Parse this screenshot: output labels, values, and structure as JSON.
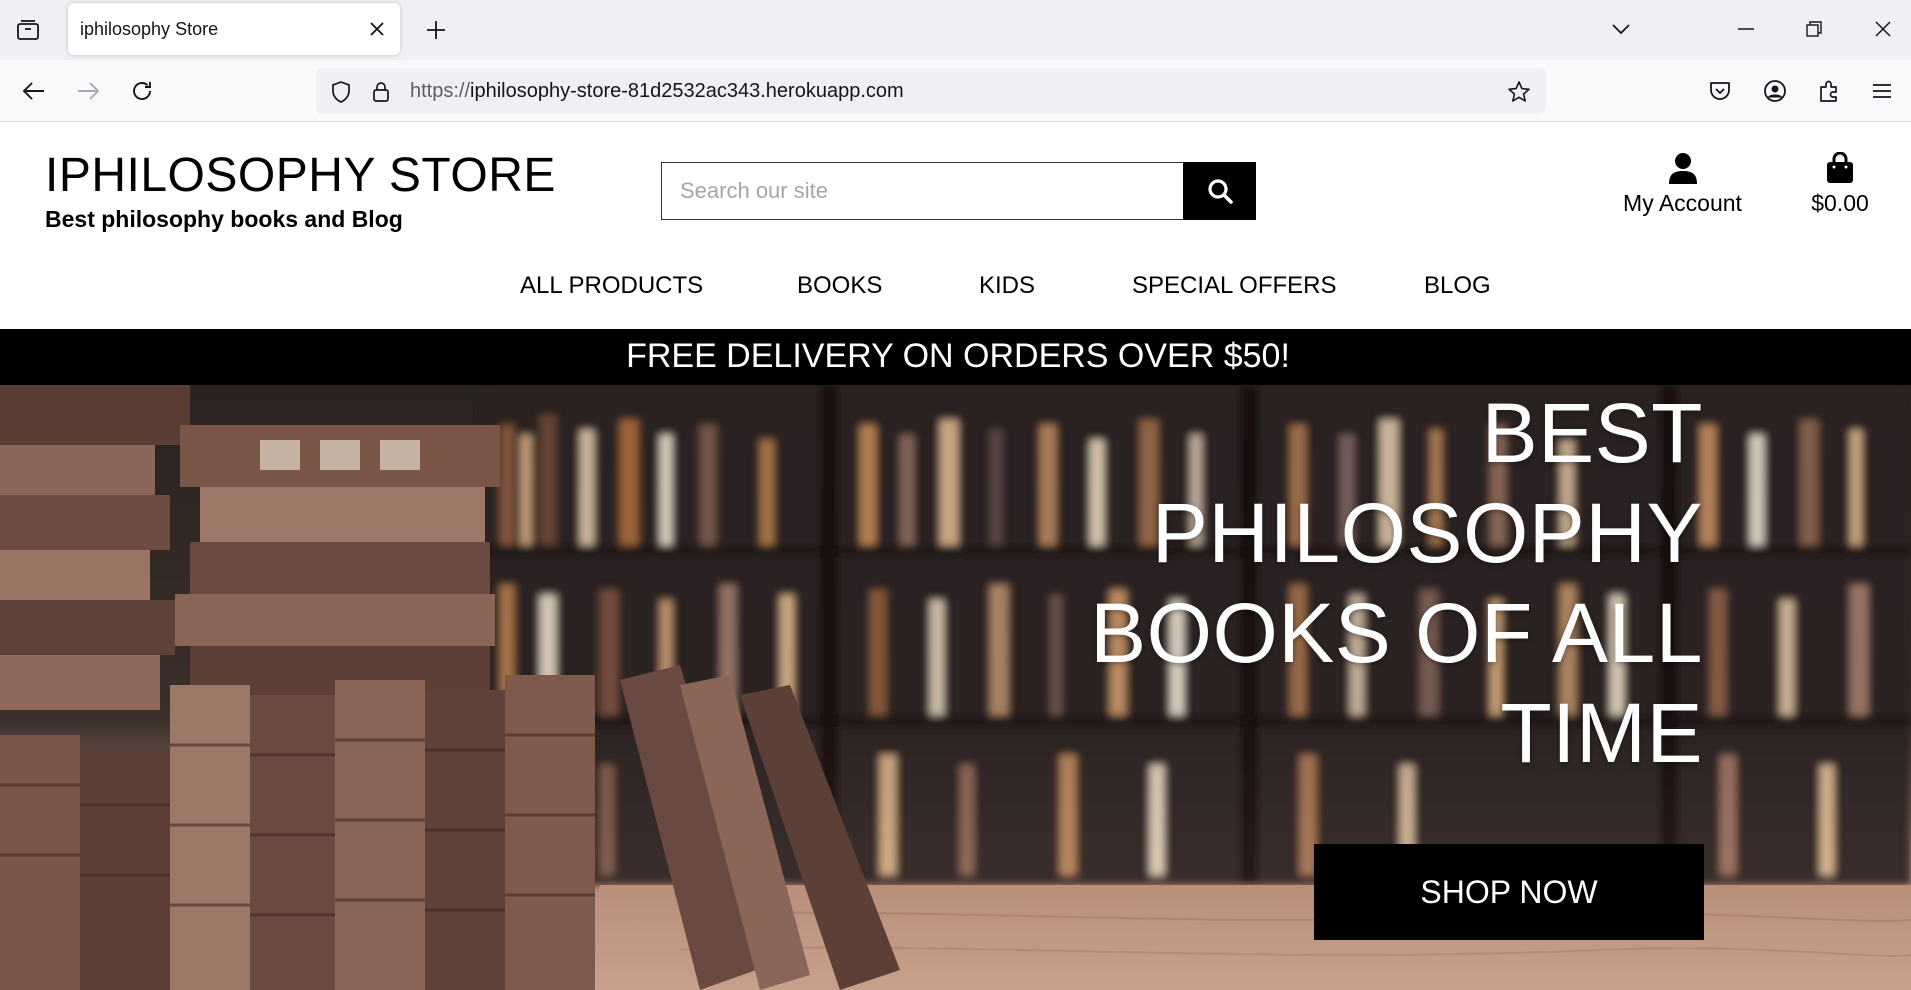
{
  "browser": {
    "tab_title": "iphilosophy Store",
    "url_scheme": "https://",
    "url_host": "iphilosophy-store-81d2532ac343.herokuapp.com"
  },
  "site": {
    "title": "IPHILOSOPHY STORE",
    "tagline": "Best philosophy books and Blog",
    "search_placeholder": "Search our site",
    "account_label": "My Account",
    "cart_total": "$0.00"
  },
  "nav": {
    "items": [
      "ALL PRODUCTS",
      "BOOKS",
      "KIDS",
      "SPECIAL OFFERS",
      "BLOG"
    ]
  },
  "promo": {
    "text": "FREE DELIVERY ON ORDERS OVER $50!"
  },
  "hero": {
    "heading": "BEST PHILOSOPHY BOOKS OF ALL TIME",
    "cta": "SHOP NOW"
  },
  "colors": {
    "chrome_bg": "#f0f0f4",
    "banner_bg": "#000000",
    "button_bg": "#000000",
    "text_on_dark": "#ffffff"
  },
  "icons": {
    "tab_list": "tab-list-icon",
    "close_tab": "close-icon",
    "new_tab": "plus-icon",
    "back": "arrow-left-icon",
    "forward": "arrow-right-icon",
    "reload": "reload-icon",
    "tracking": "shield-icon",
    "secure": "lock-icon",
    "bookmark": "star-icon",
    "pocket": "pocket-icon",
    "account": "account-icon",
    "extensions": "puzzle-icon",
    "menu": "hamburger-icon",
    "search": "search-icon",
    "user": "user-icon",
    "cart": "shopping-bag-icon"
  }
}
